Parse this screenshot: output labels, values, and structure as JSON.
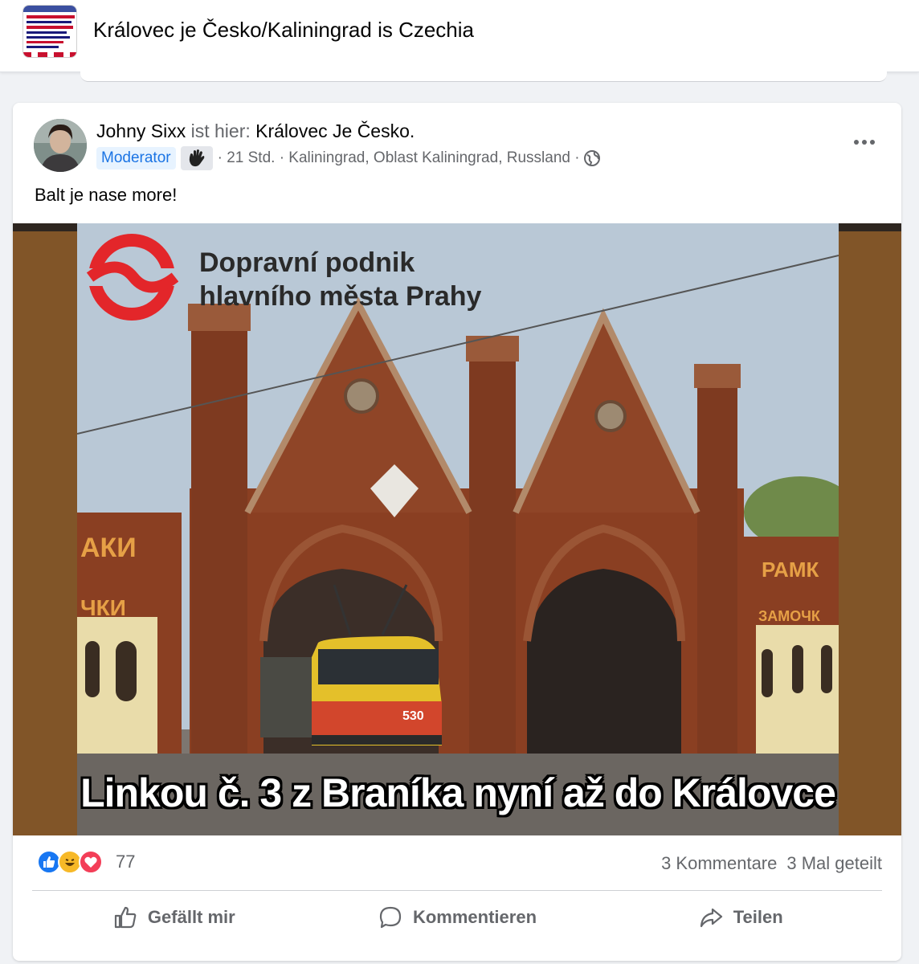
{
  "group": {
    "title": "Královec je Česko/Kaliningrad is Czechia"
  },
  "post": {
    "author": "Johny Sixx",
    "verb": " ist hier: ",
    "group_link": "Královec Je Česko.",
    "badge": "Moderator",
    "meta": "· 21 Std. · Kaliningrad, Oblast Kaliningrad, Russland ·",
    "text": "Balt je nase more!",
    "image": {
      "logo_line1": "Dopravní podnik",
      "logo_line2": "hlavního města Prahy",
      "caption": "Linkou č. 3 z Braníka nyní až do Královce",
      "tram_number": "530",
      "sign_left_1": "АКИ",
      "sign_left_2": "ЧКИ",
      "sign_right_1": "РАМК",
      "sign_right_2": "ЗАМОЧК"
    },
    "reactions": {
      "icons": [
        "like-icon",
        "haha-icon",
        "love-icon"
      ],
      "count": "77",
      "comments": "3 Kommentare",
      "shares": "3 Mal geteilt"
    },
    "actions": {
      "like": "Gefällt mir",
      "comment": "Kommentieren",
      "share": "Teilen"
    }
  },
  "colors": {
    "accent": "#1b74e4",
    "like_blue": "#1877f2",
    "haha_yellow": "#f7b928",
    "love_red": "#f33e58",
    "image_border_brown": "#815528",
    "brick": "#8a3f22",
    "dpp_red": "#e3262a"
  }
}
